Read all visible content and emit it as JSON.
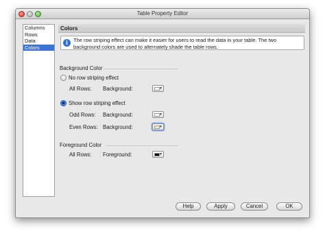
{
  "window": {
    "title": "Table Property Editor"
  },
  "sidebar": {
    "items": [
      {
        "label": "Columns"
      },
      {
        "label": "Rows"
      },
      {
        "label": "Data"
      },
      {
        "label": "Colors"
      }
    ],
    "selected_index": 3
  },
  "panel": {
    "header": "Colors",
    "info_line1": "The row striping effect can make it easier for users to read the data in your table. The two",
    "info_line2": "background colors are used to alternately shade the table rows."
  },
  "background": {
    "section_title": "Background Color",
    "no_striping_label": "No row striping effect",
    "all_rows_label": "All Rows:",
    "all_rows_bg_label": "Background:",
    "all_rows_color": "#ffffff",
    "show_striping_label": "Show row striping effect",
    "show_striping_selected": true,
    "odd_rows_label": "Odd Rows:",
    "odd_rows_bg_label": "Background:",
    "odd_rows_color": "#ffffff",
    "even_rows_label": "Even Rows:",
    "even_rows_bg_label": "Background:",
    "even_rows_color": "#f3e4c8"
  },
  "foreground": {
    "section_title": "Foreground Color",
    "all_rows_label": "All Rows:",
    "fg_label": "Foreground:",
    "color": "#000000"
  },
  "buttons": {
    "help": "Help",
    "apply": "Apply",
    "cancel": "Cancel",
    "ok": "OK"
  },
  "icons": {
    "info": "info-icon",
    "dropdown": "chevron-down-icon"
  }
}
